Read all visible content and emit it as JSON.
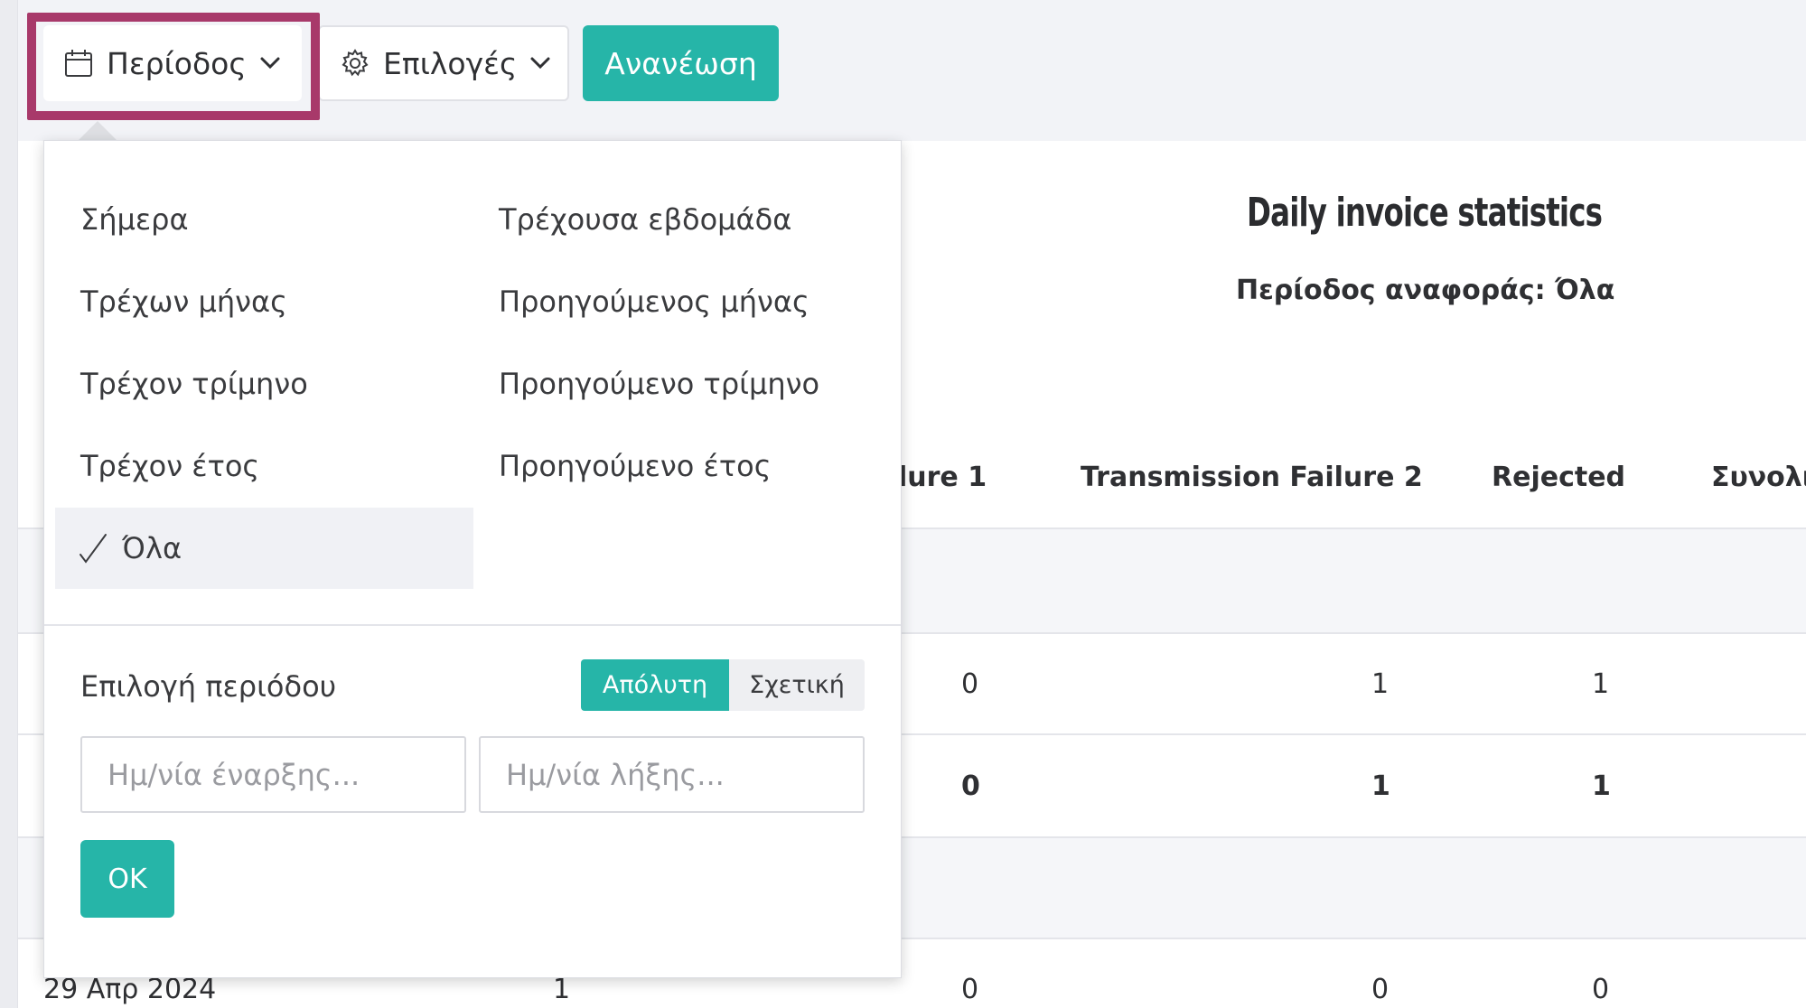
{
  "toolbar": {
    "period_label": "Περίοδος",
    "options_label": "Επιλογές",
    "refresh_label": "Ανανέωση"
  },
  "report": {
    "title": "Daily invoice statistics",
    "subtitle": "Περίοδος αναφοράς: Όλα"
  },
  "table": {
    "headers": [
      "lure 1",
      "Transmission Failure 2",
      "Rejected",
      "Συνολι"
    ],
    "rows": [
      [
        "0",
        "1",
        "1"
      ],
      [
        "0",
        "1",
        "1"
      ],
      [
        "1",
        "0",
        "0",
        "0"
      ]
    ],
    "last_row_date": "29 Απρ 2024"
  },
  "period_menu": {
    "left": [
      "Σήμερα",
      "Τρέχων μήνας",
      "Τρέχον τρίμηνο",
      "Τρέχον έτος"
    ],
    "right": [
      "Τρέχουσα εβδομάδα",
      "Προηγούμενος μήνας",
      "Προηγούμενο τρίμηνο",
      "Προηγούμενο έτος"
    ],
    "selected": "Όλα",
    "range_label": "Επιλογή περιόδου",
    "mode_absolute": "Απόλυτη",
    "mode_relative": "Σχετική",
    "start_placeholder": "Ημ/νία έναρξης...",
    "end_placeholder": "Ημ/νία λήξης...",
    "ok_label": "OK"
  },
  "colors": {
    "accent": "#26b5a8",
    "highlight": "#a8396a"
  }
}
